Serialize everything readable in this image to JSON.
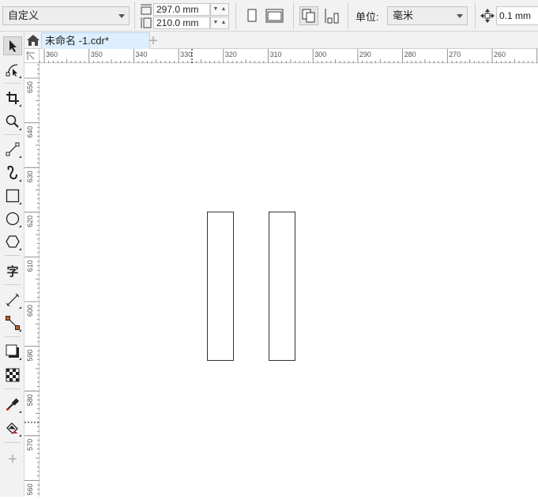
{
  "propbar": {
    "page_preset": "自定义",
    "width_value": "297.0 mm",
    "height_value": "210.0 mm",
    "unit_label": "单位:",
    "unit_value": "毫米",
    "nudge_value": "0.1 mm"
  },
  "tabs": {
    "doc_title": "未命名 -1.cdr*",
    "add": "+"
  },
  "ruler": {
    "h_ticks": [
      "360",
      "350",
      "340",
      "330",
      "320",
      "310",
      "300",
      "290",
      "280",
      "270",
      "260",
      "2"
    ],
    "v_ticks": [
      "650",
      "640",
      "630",
      "620",
      "610",
      "600",
      "590",
      "580",
      "570",
      "560"
    ]
  },
  "toolbox": {
    "text_tool": "字",
    "add": "+"
  },
  "icons": [
    "pointer-icon",
    "shape-edit-icon",
    "crop-icon",
    "zoom-icon",
    "freehand-icon",
    "artistic-media-icon",
    "rectangle-icon",
    "ellipse-icon",
    "polygon-icon",
    "text-icon",
    "parallel-dimension-icon",
    "connector-icon",
    "drop-shadow-icon",
    "transparency-icon",
    "eyedropper-icon",
    "interactive-fill-icon",
    "add-tool-icon",
    "home-icon",
    "portrait-icon",
    "landscape-icon",
    "all-pages-icon",
    "current-page-icon",
    "nudge-icon"
  ]
}
